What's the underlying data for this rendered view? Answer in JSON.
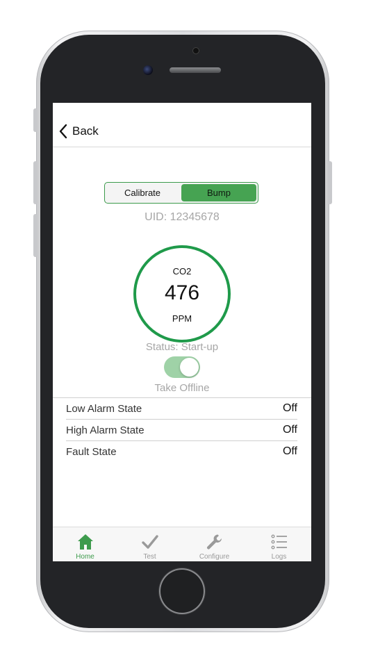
{
  "colors": {
    "accent": "#46a352",
    "gauge_ring": "#1f9a4a",
    "muted_text": "#a6a6a6",
    "tab_active": "#3e9b4d",
    "tab_inactive": "#9a9a9a"
  },
  "nav": {
    "back_label": "Back",
    "back_icon": "chevron-left-icon"
  },
  "segment": {
    "options": [
      {
        "label": "Calibrate",
        "selected": false
      },
      {
        "label": "Bump",
        "selected": true
      }
    ]
  },
  "uid": "UID: 12345678",
  "gauge": {
    "gas": "CO2",
    "value": "476",
    "unit": "PPM"
  },
  "status": "Status: Start-up",
  "toggle": {
    "label": "Take Offline",
    "on": true
  },
  "states": [
    {
      "label": "Low Alarm State",
      "value": "Off"
    },
    {
      "label": "High Alarm State",
      "value": "Off"
    },
    {
      "label": "Fault State",
      "value": "Off"
    }
  ],
  "tabs": [
    {
      "label": "Home",
      "icon": "home-icon",
      "active": true
    },
    {
      "label": "Test",
      "icon": "checkmark-icon",
      "active": false
    },
    {
      "label": "Configure",
      "icon": "wrench-icon",
      "active": false
    },
    {
      "label": "Logs",
      "icon": "list-icon",
      "active": false
    }
  ]
}
